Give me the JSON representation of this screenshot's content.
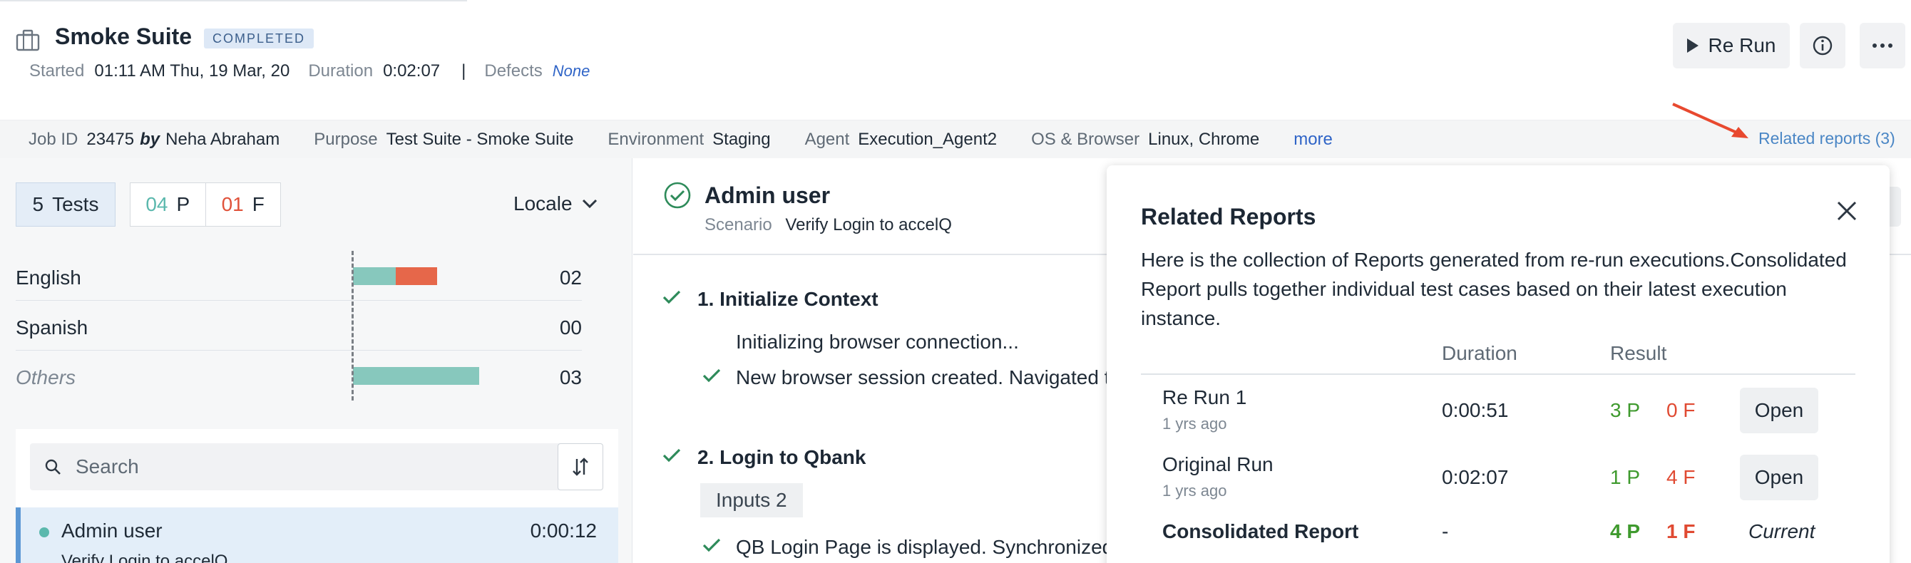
{
  "header": {
    "title": "Smoke Suite",
    "status": "COMPLETED",
    "started_label": "Started",
    "started_value": "01:11 AM Thu, 19 Mar, 20",
    "duration_label": "Duration",
    "duration_value": "0:02:07",
    "separator": "|",
    "defects_label": "Defects",
    "defects_value": "None",
    "rerun_label": "Re Run"
  },
  "infobar": {
    "job_label": "Job ID",
    "job_value": "23475",
    "by": "by",
    "author": "Neha Abraham",
    "purpose_label": "Purpose",
    "purpose_value": "Test Suite - Smoke Suite",
    "env_label": "Environment",
    "env_value": "Staging",
    "agent_label": "Agent",
    "agent_value": "Execution_Agent2",
    "os_label": "OS & Browser",
    "os_value": "Linux, Chrome",
    "more": "more",
    "related_link": "Related reports (3)"
  },
  "summary": {
    "tests_count": "5",
    "tests_label": "Tests",
    "pass_count": "04",
    "pass_label": "P",
    "fail_count": "01",
    "fail_label": "F",
    "group_by": "Locale"
  },
  "locales": [
    {
      "name": "English",
      "count": "02",
      "pass_fraction": 0.34,
      "fail_fraction": 0.33
    },
    {
      "name": "Spanish",
      "count": "00",
      "pass_fraction": 0,
      "fail_fraction": 0
    },
    {
      "name": "Others",
      "count": "03",
      "pass_fraction": 1.0,
      "fail_fraction": 0
    }
  ],
  "search": {
    "placeholder": "Search"
  },
  "list": {
    "item": {
      "title": "Admin user",
      "subtitle": "Verify Login to accelQ",
      "duration": "0:00:12"
    }
  },
  "scenario": {
    "title": "Admin user",
    "label": "Scenario",
    "value": "Verify Login to accelQ"
  },
  "steps": [
    {
      "title": "1. Initialize Context",
      "lines": [
        "Initializing browser connection...",
        "New browser session created. Navigated to"
      ]
    },
    {
      "title": "2. Login to Qbank",
      "chip": "Inputs 2",
      "lines": [
        "QB Login Page is displayed. Synchronized o"
      ]
    }
  ],
  "related": {
    "title": "Related Reports",
    "description": "Here is the collection of Reports generated from re-run executions.Consolidated Report pulls together individual test cases based on their latest execution instance.",
    "col_duration": "Duration",
    "col_result": "Result",
    "rows": [
      {
        "name": "Re Run 1",
        "ago": "1 yrs ago",
        "duration": "0:00:51",
        "pass": "3 P",
        "fail": "0 F",
        "action": "Open"
      },
      {
        "name": "Original Run",
        "ago": "1 yrs ago",
        "duration": "0:02:07",
        "pass": "1 P",
        "fail": "4 F",
        "action": "Open"
      },
      {
        "name": "Consolidated Report",
        "ago": "",
        "duration": "-",
        "pass": "4 P",
        "fail": "1 F",
        "action": "Current"
      }
    ]
  },
  "colors": {
    "pass": "#87c8bd",
    "fail": "#e6674a",
    "accent": "#5b97d4",
    "link": "#2f64c7",
    "result_pass": "#3f9a2e",
    "result_fail": "#e04a32",
    "annotation_arrow": "#e8492f"
  }
}
